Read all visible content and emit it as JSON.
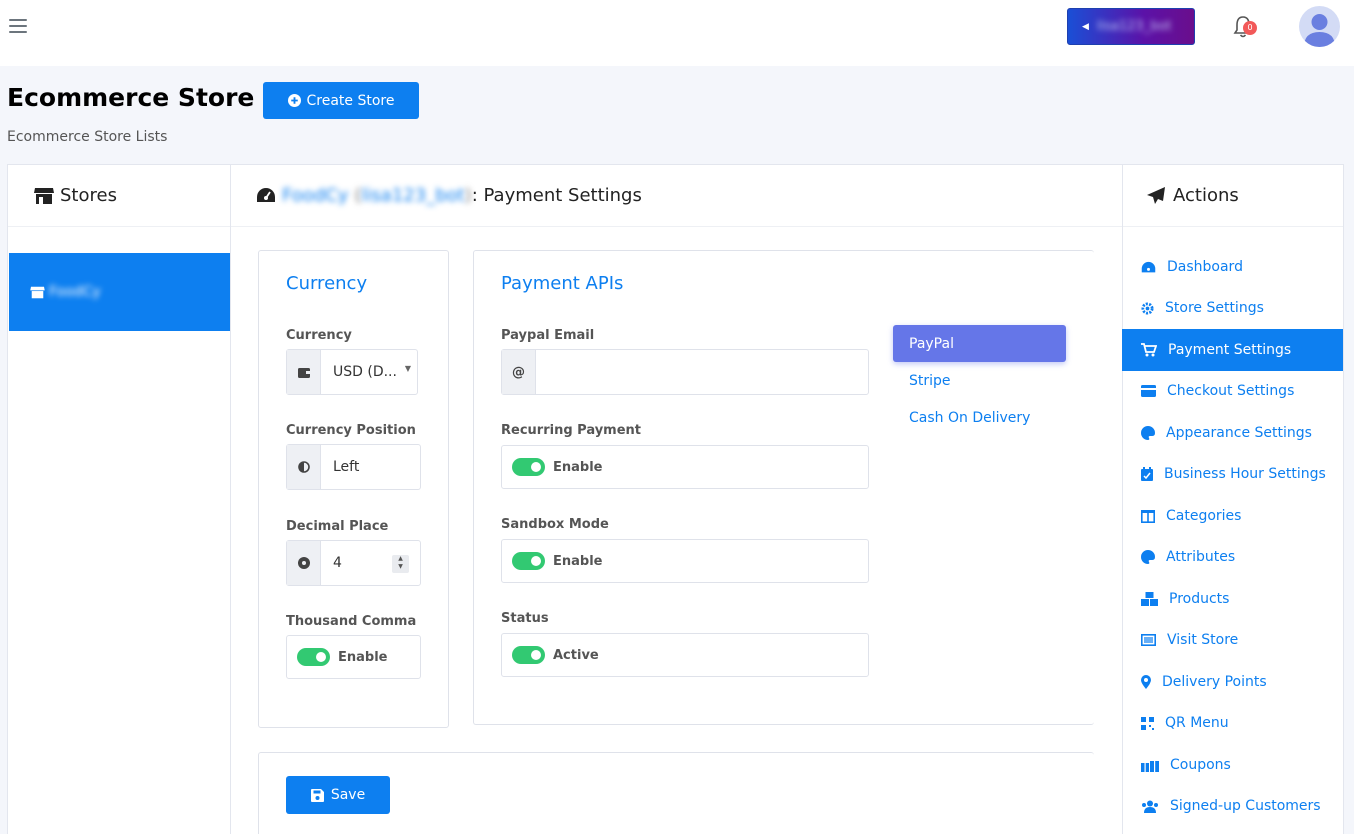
{
  "topbar": {
    "account_label": "lisa123_bot",
    "notification_count": "0"
  },
  "page": {
    "title": "Ecommerce Store",
    "create_button": "Create Store",
    "subtitle": "Ecommerce Store Lists"
  },
  "stores": {
    "header": "Stores",
    "items": [
      {
        "name": "FoodCy"
      }
    ]
  },
  "main": {
    "store_name": "FoodCy",
    "bot_name": "lisa123_bot",
    "header_suffix": ": Payment Settings",
    "currency_card": {
      "title": "Currency",
      "currency_label": "Currency",
      "currency_value": "USD (D...",
      "position_label": "Currency Position",
      "position_value": "Left",
      "decimal_label": "Decimal Place",
      "decimal_value": "4",
      "thousand_label": "Thousand Comma",
      "thousand_toggle": "Enable"
    },
    "payment_card": {
      "title": "Payment APIs",
      "paypal_email_label": "Paypal Email",
      "paypal_email_value": "",
      "email_addon": "@",
      "recurring_label": "Recurring Payment",
      "recurring_toggle": "Enable",
      "sandbox_label": "Sandbox Mode",
      "sandbox_toggle": "Enable",
      "status_label": "Status",
      "status_toggle": "Active"
    },
    "payment_tabs": [
      "PayPal",
      "Stripe",
      "Cash On Delivery"
    ],
    "save_button": "Save"
  },
  "actions": {
    "header": "Actions",
    "items": [
      {
        "label": "Dashboard",
        "icon": "tachometer-icon"
      },
      {
        "label": "Store Settings",
        "icon": "gear-icon"
      },
      {
        "label": "Payment Settings",
        "icon": "cart-icon"
      },
      {
        "label": "Checkout Settings",
        "icon": "credit-card-icon"
      },
      {
        "label": "Appearance Settings",
        "icon": "palette-icon"
      },
      {
        "label": "Business Hour Settings",
        "icon": "calendar-check-icon"
      },
      {
        "label": "Categories",
        "icon": "columns-icon"
      },
      {
        "label": "Attributes",
        "icon": "palette-icon"
      },
      {
        "label": "Products",
        "icon": "boxes-icon"
      },
      {
        "label": "Visit Store",
        "icon": "list-icon"
      },
      {
        "label": "Delivery Points",
        "icon": "map-marker-icon"
      },
      {
        "label": "QR Menu",
        "icon": "qrcode-icon"
      },
      {
        "label": "Coupons",
        "icon": "gifts-icon"
      },
      {
        "label": "Signed-up Customers",
        "icon": "users-icon"
      }
    ]
  },
  "colors": {
    "primary": "#0d7ff0",
    "active_tab": "#6576e8",
    "toggle_on": "#32c972",
    "badge": "#f25959"
  }
}
